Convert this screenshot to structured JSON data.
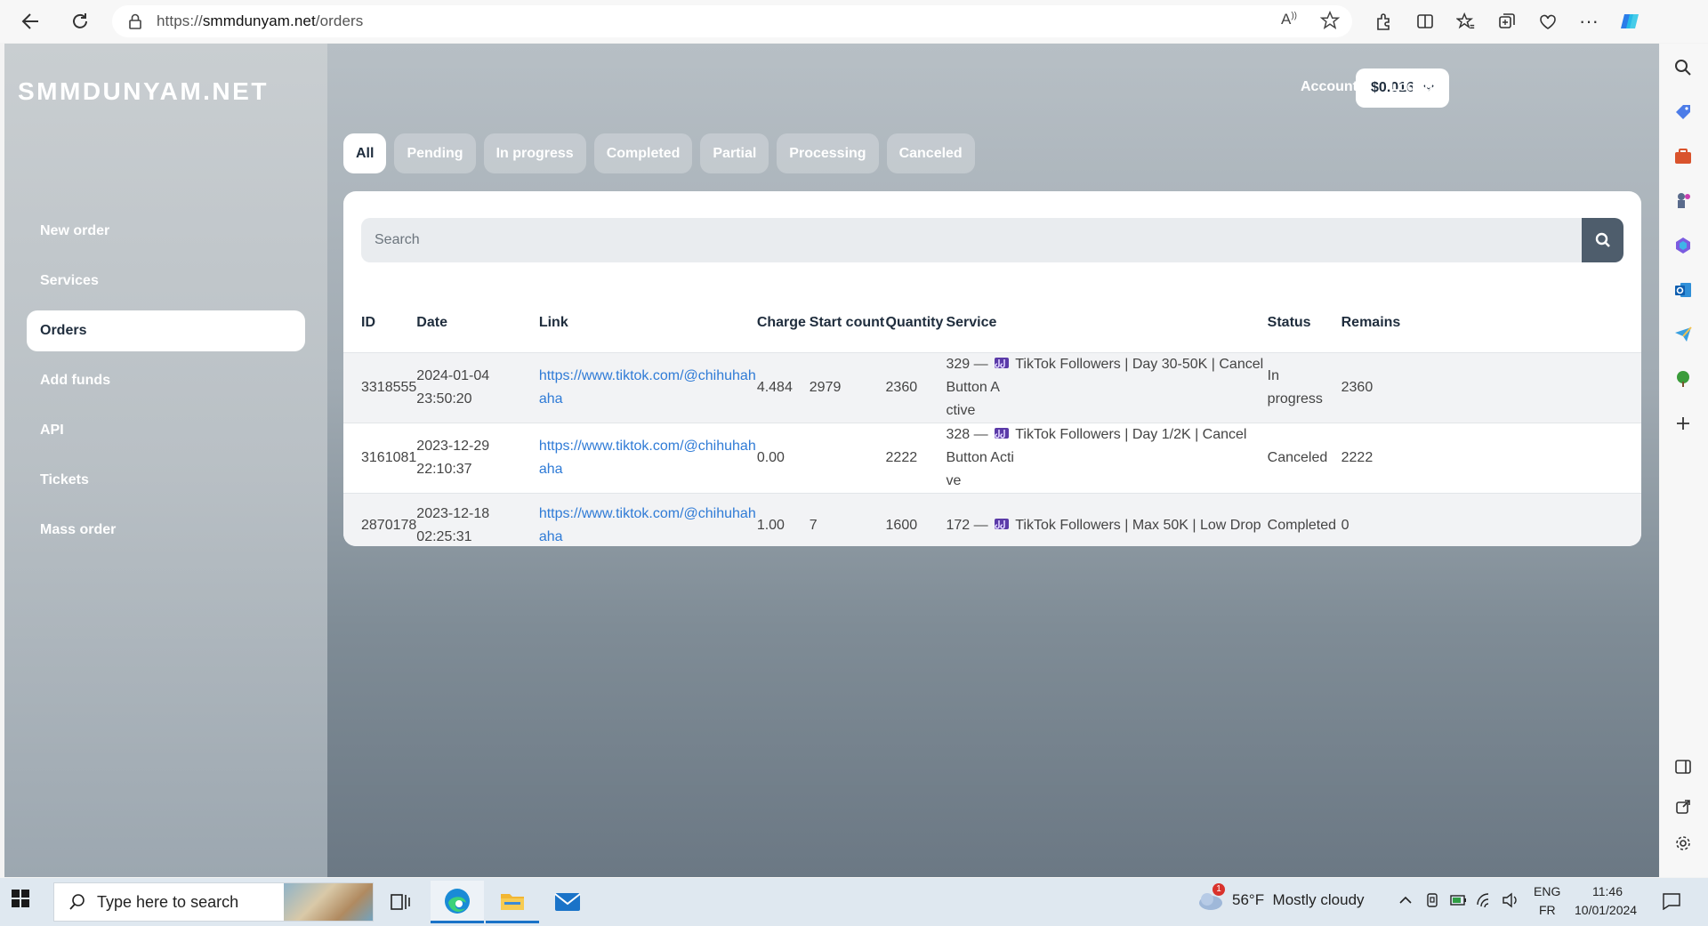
{
  "browser": {
    "url_prefix": "https://",
    "url_host": "smmdunyam.net",
    "url_path": "/orders"
  },
  "site": {
    "brand": "SMMDUNYAM.NET",
    "balance": "$0.016",
    "account_label": "Account",
    "logout_label": "Logout"
  },
  "sidebar": {
    "items": [
      {
        "label": "New order"
      },
      {
        "label": "Services"
      },
      {
        "label": "Orders"
      },
      {
        "label": "Add funds"
      },
      {
        "label": "API"
      },
      {
        "label": "Tickets"
      },
      {
        "label": "Mass order"
      }
    ]
  },
  "filters": [
    "All",
    "Pending",
    "In progress",
    "Completed",
    "Partial",
    "Processing",
    "Canceled"
  ],
  "search": {
    "placeholder": "Search"
  },
  "table": {
    "headers": [
      "ID",
      "Date",
      "Link",
      "Charge",
      "Start count",
      "Quantity",
      "Service",
      "Status",
      "Remains"
    ],
    "rows": [
      {
        "id": "3318555",
        "date_line1": "2024-01-04",
        "date_line2": "23:50:20",
        "link_line1": "https://www.tiktok.com/@chihuhah",
        "link_line2": "aha",
        "charge": "4.484",
        "start_count": "2979",
        "quantity": "2360",
        "service_prefix": "329 —",
        "service_line1": "TikTok Followers | Day 30-50K | Cancel Button A",
        "service_line2": "ctive",
        "status_line1": "In",
        "status_line2": "progress",
        "remains": "2360"
      },
      {
        "id": "3161081",
        "date_line1": "2023-12-29",
        "date_line2": "22:10:37",
        "link_line1": "https://www.tiktok.com/@chihuhah",
        "link_line2": "aha",
        "charge": "0.00",
        "start_count": "",
        "quantity": "2222",
        "service_prefix": "328 —",
        "service_line1": "TikTok Followers | Day 1/2K | Cancel Button Acti",
        "service_line2": "ve",
        "status_line1": "Canceled",
        "status_line2": "",
        "remains": "2222"
      },
      {
        "id": "2870178",
        "date_line1": "2023-12-18 02:25:31",
        "date_line2": "",
        "link_line1": "https://www.tiktok.com/@chihuhah",
        "link_line2": "aha",
        "charge": "1.00",
        "start_count": "7",
        "quantity": "1600",
        "service_prefix": "172 —",
        "service_line1": "TikTok Followers | Max 50K | Low Drop",
        "service_line2": "",
        "status_line1": "Completed",
        "status_line2": "",
        "remains": "0"
      }
    ]
  },
  "taskbar": {
    "search_placeholder": "Type here to search",
    "weather": "56°F  Mostly cloudy",
    "weather_badge": "1",
    "lang_top": "ENG",
    "lang_bottom": "FR",
    "time": "11:46",
    "date": "10/01/2024"
  },
  "colors": {
    "accent_link": "#2f7bd6",
    "sidebar_text": "#ffffff",
    "search_button": "#4e5d6c"
  }
}
